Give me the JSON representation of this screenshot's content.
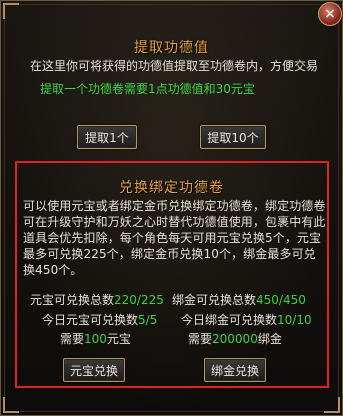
{
  "window": {
    "close_glyph": "×"
  },
  "section1": {
    "title": "提取功德值",
    "desc": "在这里你可将获得的功德值提取至功德卷内，方便交易",
    "rate": "提取一个功德卷需要1点功德值和30元宝",
    "buttons": [
      "提取1个",
      "提取10个"
    ]
  },
  "section2": {
    "title": "兑换绑定功德卷",
    "desc": "可以使用元宝或者绑定金币兑换绑定功德卷，绑定功德卷可在升级守护和万妖之心时替代功德值使用，包裹中有此道具会优先扣除，每个角色每天可用元宝兑换5个，元宝最多可兑换225个，绑定金币兑换10个，绑金最多可兑换450个。",
    "stats": {
      "yuanbao_total_label": "元宝可兑换总数",
      "yuanbao_total_value": "220/225",
      "bindgold_total_label": "绑金可兑换总数",
      "bindgold_total_value": "450/450",
      "yuanbao_today_label": "今日元宝可兑换数",
      "yuanbao_today_value": "5/5",
      "bindgold_today_label": "今日绑金可兑换数",
      "bindgold_today_value": "10/10",
      "need_label": "需要",
      "yuanbao_cost": "100",
      "yuanbao_unit": "元宝",
      "bindgold_cost": "200000",
      "bindgold_unit": "绑金"
    },
    "buttons": [
      "元宝兑换",
      "绑金兑换"
    ]
  },
  "colors": {
    "title": "#e8a33a",
    "highlight": "#3fd23f",
    "selection_border": "#e12222"
  }
}
